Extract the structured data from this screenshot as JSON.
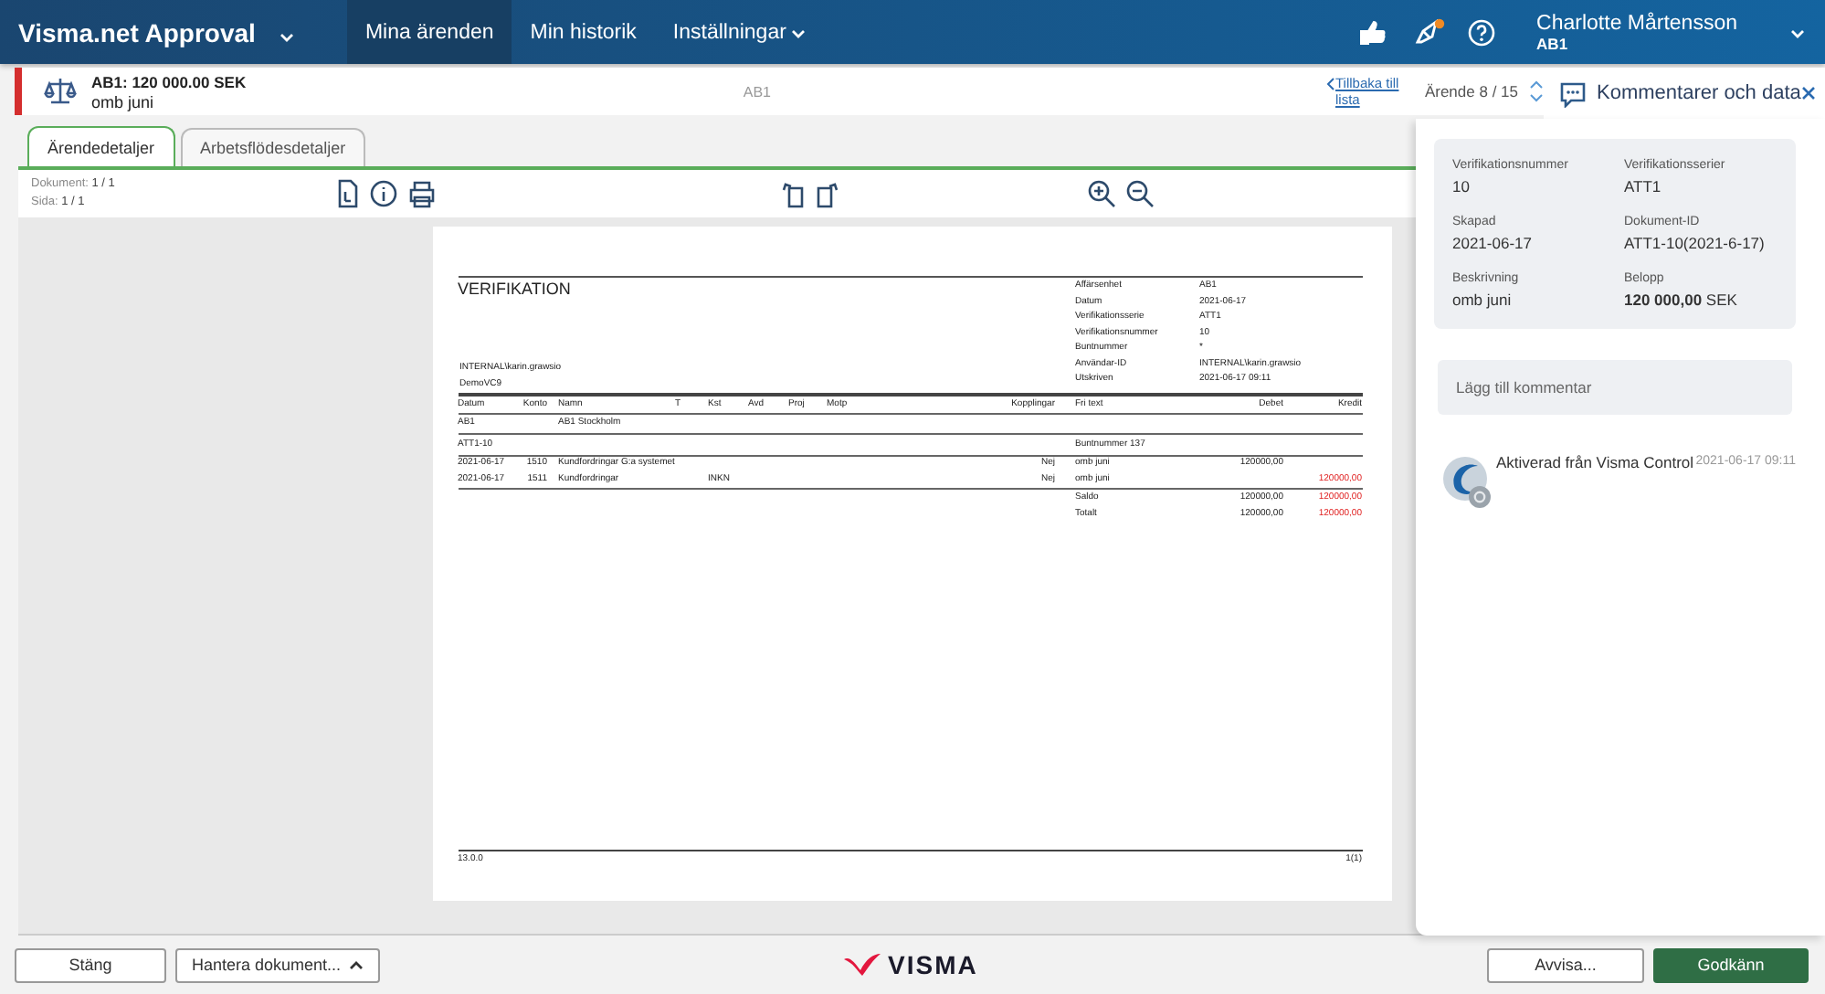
{
  "app": {
    "title": "Visma.net Approval"
  },
  "nav": [
    {
      "label": "Mina ärenden",
      "selected": true,
      "dropdown": false
    },
    {
      "label": "Min historik",
      "selected": false,
      "dropdown": false
    },
    {
      "label": "Inställningar",
      "selected": false,
      "dropdown": true
    }
  ],
  "notifications": {
    "unread": true
  },
  "user": {
    "name": "Charlotte Mårtensson",
    "company": "AB1"
  },
  "case": {
    "title": "AB1: 120 000.00 SEK",
    "description": "omb juni",
    "company": "AB1",
    "back_link": "Tillbaka till lista",
    "counter": "Ärende 8 / 15"
  },
  "tabs": [
    {
      "label": "Ärendedetaljer",
      "selected": true
    },
    {
      "label": "Arbetsflödesdetaljer",
      "selected": false
    }
  ],
  "toolbar": {
    "document": "Dokument: **1 / 1**",
    "page": "Sida: **1 / 1**"
  },
  "document": {
    "title": "VERIFIKATION",
    "user": "INTERNAL\\karin.grawsio",
    "database": "DemoVC9",
    "fields": [
      {
        "label": "Affärsenhet",
        "value": "AB1"
      },
      {
        "label": "Datum",
        "value": "2021-06-17"
      },
      {
        "label": "Verifikationsserie",
        "value": "ATT1"
      },
      {
        "label": "Verifikationsnummer",
        "value": "10"
      },
      {
        "label": "Buntnummer",
        "value": "*"
      },
      {
        "label": "Användar-ID",
        "value": "INTERNAL\\karin.grawsio"
      },
      {
        "label": "Utskriven",
        "value": "2021-06-17 09:11"
      }
    ],
    "columns": [
      "Datum",
      "Konto",
      "Namn",
      "T",
      "Kst",
      "Avd",
      "Proj",
      "Motp",
      "Kopplingar",
      "Fri text",
      "Debet",
      "Kredit"
    ],
    "rows": [
      {
        "kind": "group",
        "datum": "AB1",
        "namn": "AB1  Stockholm"
      },
      {
        "kind": "group",
        "datum": "ATT1-10",
        "fri_text": "Buntnummer 137"
      },
      {
        "kind": "entry",
        "datum": "2021-06-17",
        "konto": "1510",
        "namn": "Kundfordringar G:a systemet",
        "kopplingar": "Nej",
        "fri_text": "omb juni",
        "debet": "120000,00"
      },
      {
        "kind": "entry",
        "datum": "2021-06-17",
        "konto": "1511",
        "namn": "Kundfordringar",
        "kst": "INKN",
        "kopplingar": "Nej",
        "fri_text": "omb juni",
        "kredit": "120000,00"
      },
      {
        "kind": "total",
        "fri_text": "Saldo",
        "debet": "120000,00",
        "kredit": "120000,00"
      },
      {
        "kind": "total",
        "fri_text": "Totalt",
        "debet": "120000,00",
        "kredit": "120000,00"
      }
    ],
    "version": "13.0.0",
    "page_count": "1(1)"
  },
  "panel": {
    "title": "Kommentarer och data",
    "fields": [
      {
        "label": "Verifikationsnummer",
        "value": "10"
      },
      {
        "label": "Verifikationsserier",
        "value": "ATT1"
      },
      {
        "label": "Skapad",
        "value": "2021-06-17"
      },
      {
        "label": "Dokument-ID",
        "value": "ATT1-10(2021-6-17)"
      },
      {
        "label": "Beskrivning",
        "value": "omb juni"
      },
      {
        "label": "Belopp",
        "value": "**120 000,00** SEK"
      }
    ],
    "comment_placeholder": "Lägg till kommentar",
    "comments": [
      {
        "text": "Aktiverad från Visma Control",
        "time": "2021-06-17 09:11"
      }
    ]
  },
  "footer": {
    "left_buttons": [
      "Stäng",
      "Hantera dokument..."
    ],
    "logo": "VISMA",
    "reject": "Avvisa...",
    "approve": "Godkänn"
  }
}
